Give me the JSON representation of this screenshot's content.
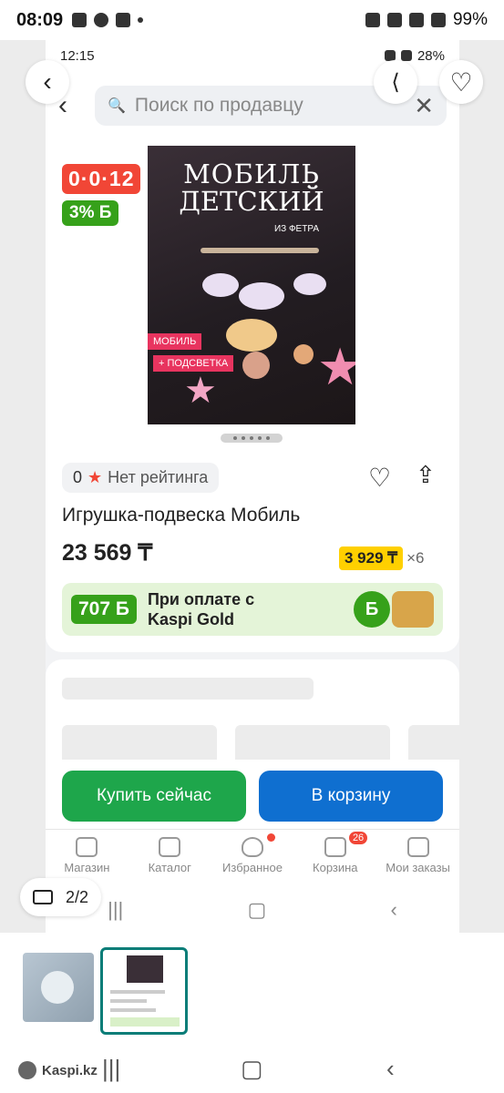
{
  "outer_status": {
    "time": "08:09",
    "battery": "99%"
  },
  "inner_status": {
    "time": "12:15",
    "battery": "28%"
  },
  "search": {
    "placeholder": "Поиск по продавцу"
  },
  "poster": {
    "title_line1": "МОБИЛЬ",
    "title_line2": "ДЕТСКИЙ",
    "subtitle": "ИЗ ФЕТРА",
    "tag1": "МОБИЛЬ",
    "tag2": "+ ПОДСВЕТКА"
  },
  "badges": {
    "timer": "0·0·12",
    "discount": "3% Б"
  },
  "rating": {
    "value": "0",
    "label": "Нет рейтинга"
  },
  "product": {
    "title": "Игрушка-подвеска Мобиль",
    "price": "23 569 ₸",
    "installment": "3 929 ₸",
    "installment_mult": "×6"
  },
  "bonus": {
    "amount": "707 Б",
    "line1": "При оплате с",
    "line2": "Kaspi Gold",
    "coin": "Б"
  },
  "buttons": {
    "buy": "Купить сейчас",
    "cart": "В корзину"
  },
  "tabs": [
    {
      "label": "Магазин"
    },
    {
      "label": "Каталог"
    },
    {
      "label": "Избранное"
    },
    {
      "label": "Корзина",
      "count": "26"
    },
    {
      "label": "Мои заказы"
    }
  ],
  "viewer": {
    "counter": "2/2"
  },
  "footer": {
    "source": "Kaspi.kz"
  },
  "colors": {
    "accent_green": "#1ea64b",
    "accent_blue": "#0f6fd0",
    "badge_red": "#f14636",
    "installment_yellow": "#ffd000"
  }
}
